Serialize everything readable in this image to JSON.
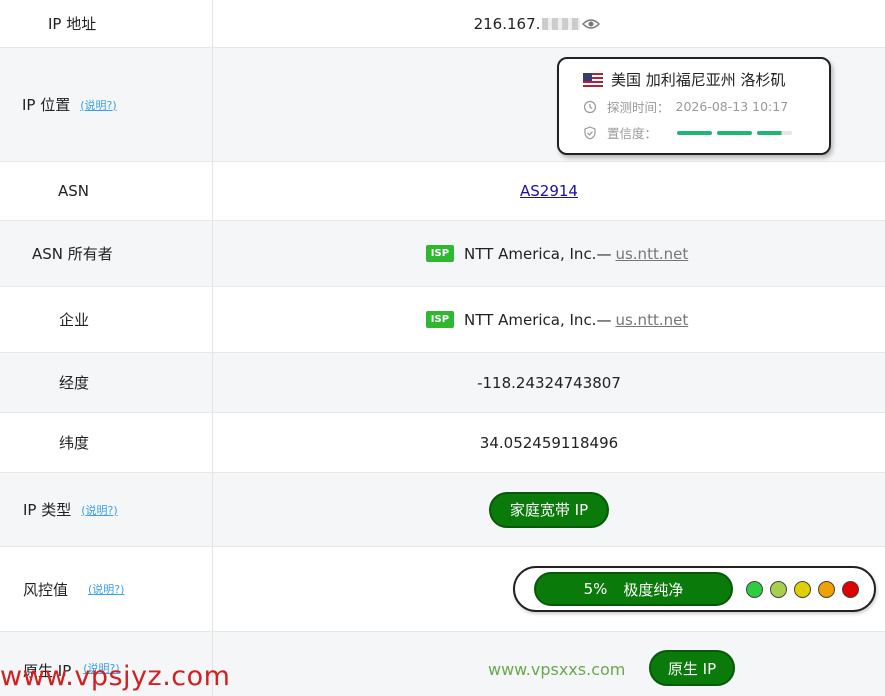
{
  "rows": {
    "ip": {
      "label": "IP 地址",
      "value": "216.167."
    },
    "location": {
      "label": "IP 位置",
      "help": "(说明?)",
      "flag": "🇺🇸",
      "place": "美国 加利福尼亚州 洛杉矶",
      "time_label": "探测时间：",
      "time_value": "2026-08-13 10:17",
      "confidence_label": "置信度：",
      "confidence_level": 0.93
    },
    "asn": {
      "label": "ASN",
      "value": "AS2914"
    },
    "asn_owner": {
      "label": "ASN 所有者",
      "tag": "ISP",
      "name": "NTT America, Inc.—",
      "link": "us.ntt.net"
    },
    "company": {
      "label": "企业",
      "tag": "ISP",
      "name": "NTT America, Inc.—",
      "link": "us.ntt.net"
    },
    "longitude": {
      "label": "经度",
      "value": "-118.24324743807"
    },
    "latitude": {
      "label": "纬度",
      "value": "34.052459118496"
    },
    "ip_type": {
      "label": "IP 类型",
      "help": "(说明?)",
      "value": "家庭宽带 IP"
    },
    "risk": {
      "label": "风控值",
      "help": "(说明?)",
      "percent": "5%",
      "text": "极度纯净",
      "dot_colors": [
        "#2ecc40",
        "#a6d04d",
        "#e0d000",
        "#f0a000",
        "#e00000"
      ]
    },
    "native": {
      "label": "原生 IP",
      "help": "(说明?)",
      "value": "原生 IP"
    }
  },
  "watermark": "www.vpsjyz.com",
  "watermark2": "www.vpsxxs.com",
  "colors": {
    "accent_green": "#0a7a0a",
    "isp_tag": "#2fb82f",
    "help_link": "#3aa0e8"
  }
}
